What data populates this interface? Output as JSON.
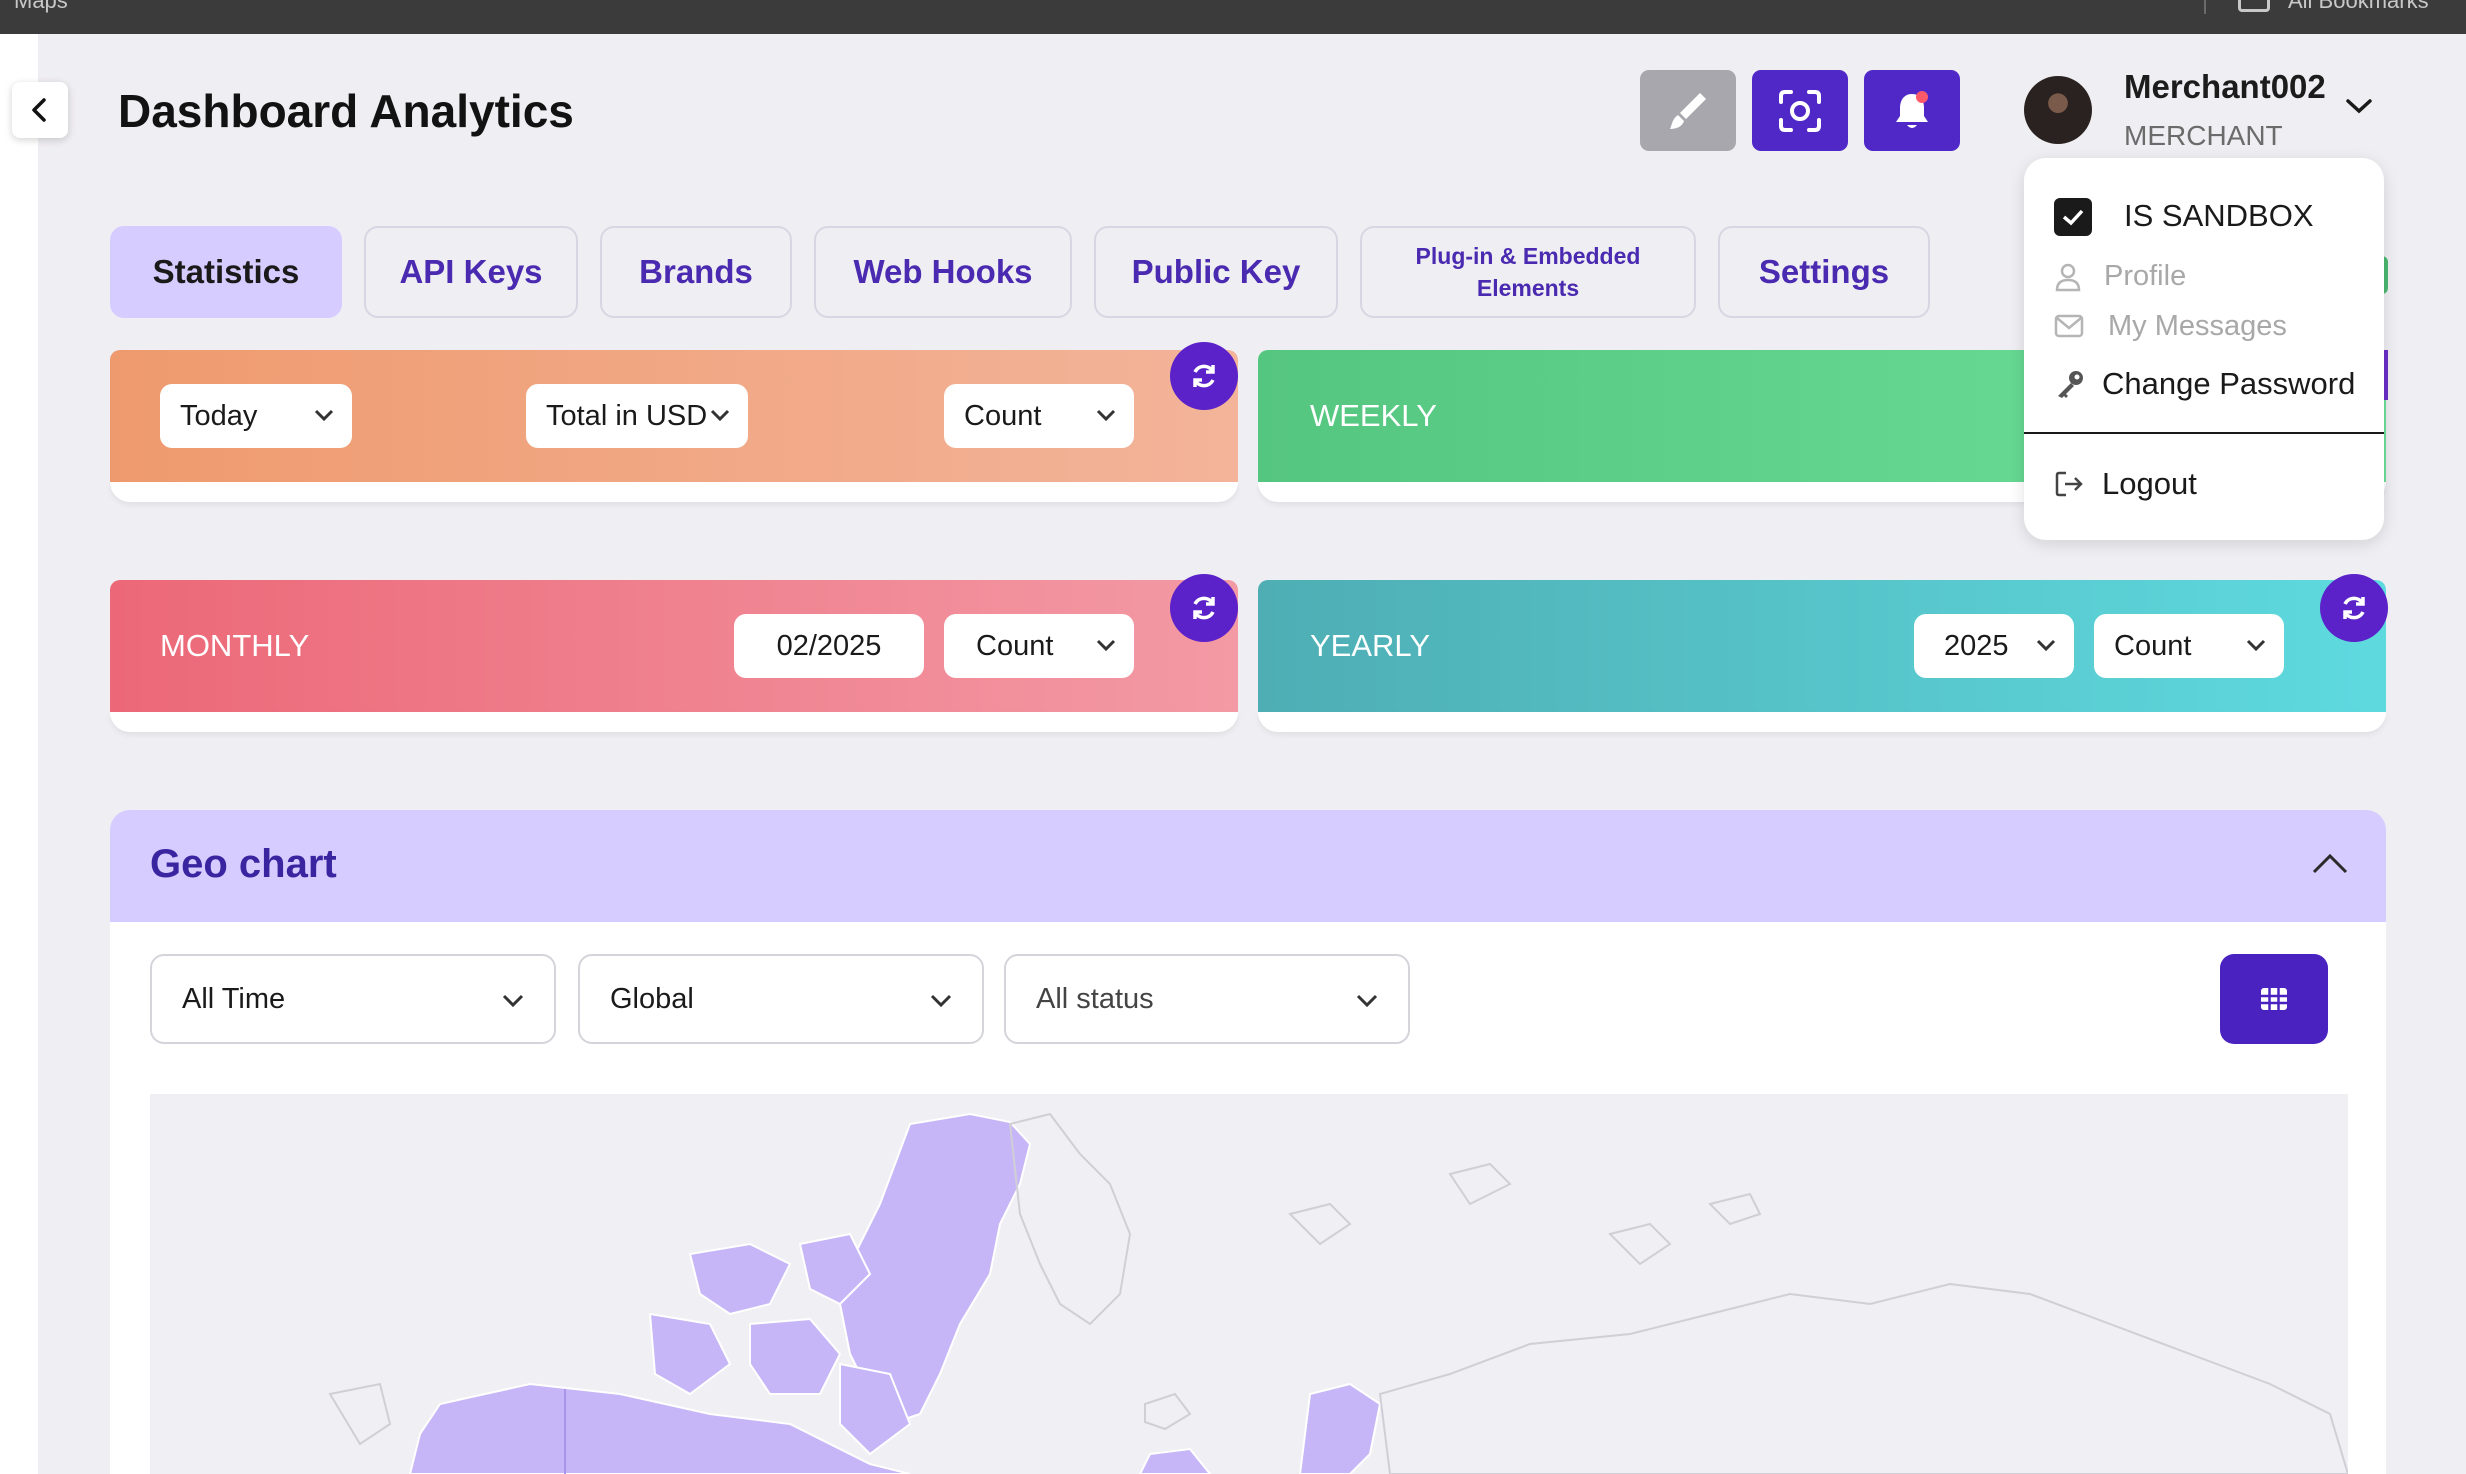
{
  "browser": {
    "bookmark_left": "Maps",
    "bookmark_right": "All Bookmarks"
  },
  "header": {
    "title": "Dashboard Analytics",
    "user_name": "Merchant002",
    "user_role": "MERCHANT"
  },
  "tabs": [
    {
      "label": "Statistics",
      "active": true
    },
    {
      "label": "API Keys"
    },
    {
      "label": "Brands"
    },
    {
      "label": "Web Hooks"
    },
    {
      "label": "Public Key"
    },
    {
      "label": "Plug-in & Embedded Elements"
    },
    {
      "label": "Settings"
    }
  ],
  "cards": {
    "daily": {
      "period": "Today",
      "currency": "Total in USD",
      "metric": "Count"
    },
    "weekly": {
      "label": "WEEKLY"
    },
    "monthly": {
      "label": "MONTHLY",
      "month": "02/2025",
      "metric": "Count"
    },
    "yearly": {
      "label": "YEARLY",
      "year": "2025",
      "metric": "Count"
    }
  },
  "user_menu": {
    "sandbox_label": "IS SANDBOX",
    "sandbox_checked": true,
    "profile": "Profile",
    "messages": "My Messages",
    "change_password": "Change Password",
    "logout": "Logout"
  },
  "geo_chart": {
    "title": "Geo chart",
    "filter_time": "All Time",
    "filter_region": "Global",
    "filter_status": "All status"
  },
  "colors": {
    "accent": "#5128c8",
    "daily_gradient": [
      "#ef9a6e",
      "#f3b49a"
    ],
    "weekly_gradient": [
      "#55c680",
      "#6ee09a"
    ],
    "monthly_gradient": [
      "#ec6878",
      "#f39aa5"
    ],
    "yearly_gradient": [
      "#4eaeb4",
      "#5edadf"
    ],
    "geo_header": "#d6ccff",
    "map_land": "#c7b6f7"
  }
}
